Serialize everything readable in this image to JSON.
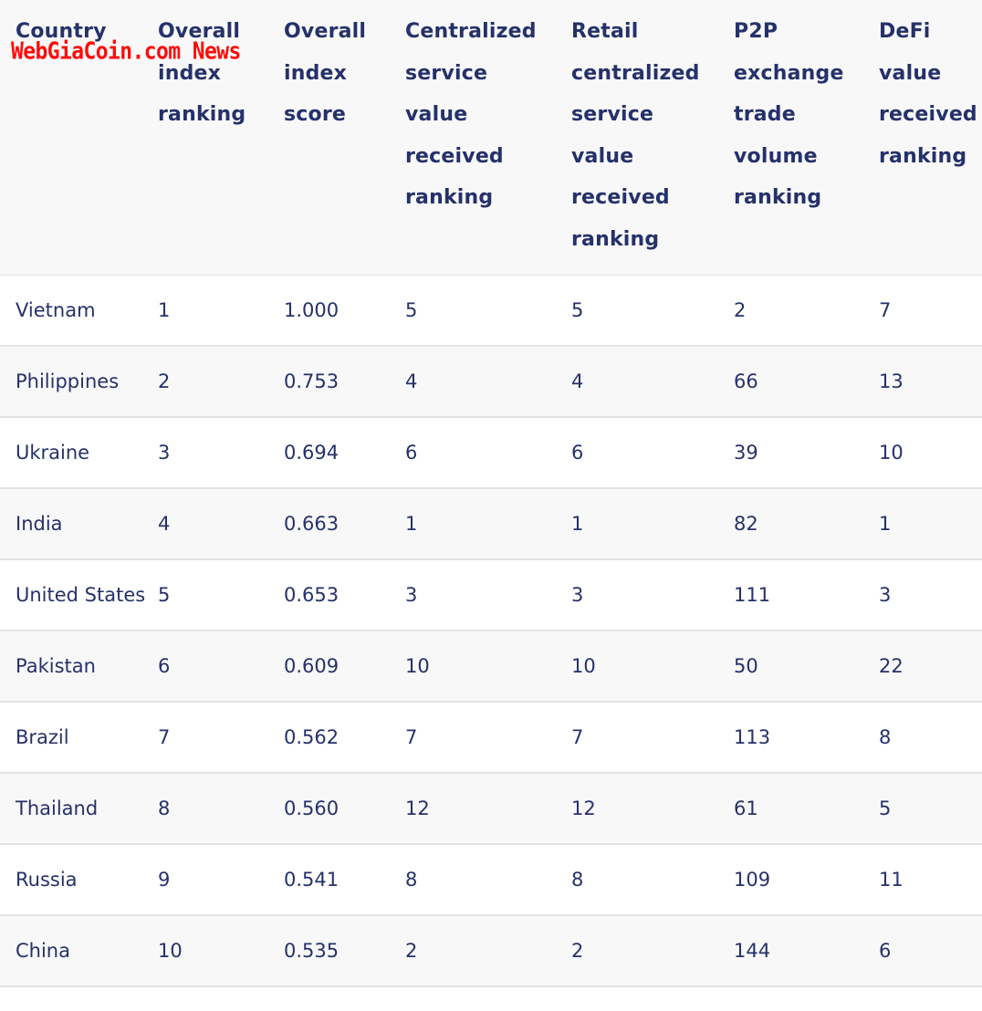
{
  "watermark": "WebGiaCoin.com News",
  "table": {
    "headers": [
      [
        "Country"
      ],
      [
        "Overall",
        "index",
        "ranking"
      ],
      [
        "Overall",
        "index",
        "score"
      ],
      [
        "Centralized",
        "service",
        "value",
        "received",
        "ranking"
      ],
      [
        "Retail",
        "centralized",
        "service",
        "value",
        "received",
        "ranking"
      ],
      [
        "P2P",
        "exchange",
        "trade",
        "volume",
        "ranking"
      ],
      [
        "DeFi",
        "value",
        "received",
        "ranking"
      ]
    ],
    "header_labels": [
      "Country",
      "Overall index ranking",
      "Overall index score",
      "Centralized service value received ranking",
      "Retail centralized service value received ranking",
      "P2P exchange trade volume ranking",
      "DeFi value received ranking"
    ],
    "rows": [
      [
        "Vietnam",
        "1",
        "1.000",
        "5",
        "5",
        "2",
        "7"
      ],
      [
        "Philippines",
        "2",
        "0.753",
        "4",
        "4",
        "66",
        "13"
      ],
      [
        "Ukraine",
        "3",
        "0.694",
        "6",
        "6",
        "39",
        "10"
      ],
      [
        "India",
        "4",
        "0.663",
        "1",
        "1",
        "82",
        "1"
      ],
      [
        "United States",
        "5",
        "0.653",
        "3",
        "3",
        "111",
        "3"
      ],
      [
        "Pakistan",
        "6",
        "0.609",
        "10",
        "10",
        "50",
        "22"
      ],
      [
        "Brazil",
        "7",
        "0.562",
        "7",
        "7",
        "113",
        "8"
      ],
      [
        "Thailand",
        "8",
        "0.560",
        "12",
        "12",
        "61",
        "5"
      ],
      [
        "Russia",
        "9",
        "0.541",
        "8",
        "8",
        "109",
        "11"
      ],
      [
        "China",
        "10",
        "0.535",
        "2",
        "2",
        "144",
        "6"
      ]
    ]
  },
  "colors": {
    "text": "#25316a",
    "header_bg": "#f8f8f8",
    "row_alt_bg": "#f8f8f8",
    "row_bg": "#ffffff",
    "border": "#e3e3e3",
    "watermark": "#ff0a0a"
  }
}
